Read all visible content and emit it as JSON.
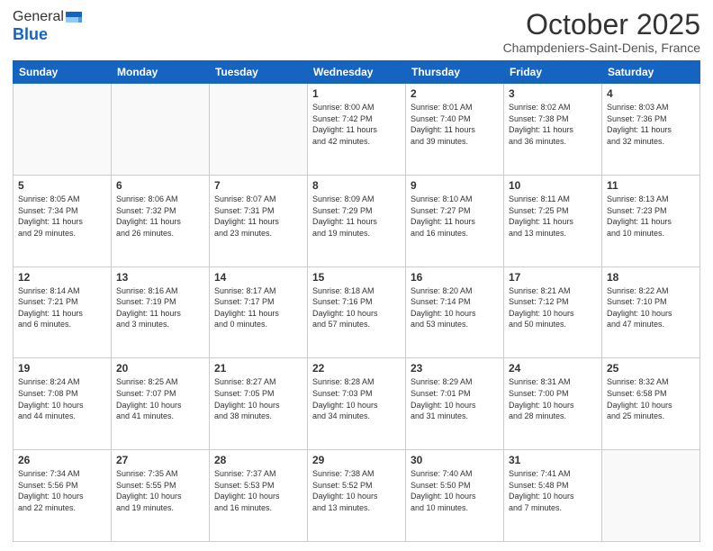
{
  "header": {
    "logo_general": "General",
    "logo_blue": "Blue",
    "month": "October 2025",
    "location": "Champdeniers-Saint-Denis, France"
  },
  "days_of_week": [
    "Sunday",
    "Monday",
    "Tuesday",
    "Wednesday",
    "Thursday",
    "Friday",
    "Saturday"
  ],
  "weeks": [
    [
      {
        "day": "",
        "info": ""
      },
      {
        "day": "",
        "info": ""
      },
      {
        "day": "",
        "info": ""
      },
      {
        "day": "1",
        "info": "Sunrise: 8:00 AM\nSunset: 7:42 PM\nDaylight: 11 hours\nand 42 minutes."
      },
      {
        "day": "2",
        "info": "Sunrise: 8:01 AM\nSunset: 7:40 PM\nDaylight: 11 hours\nand 39 minutes."
      },
      {
        "day": "3",
        "info": "Sunrise: 8:02 AM\nSunset: 7:38 PM\nDaylight: 11 hours\nand 36 minutes."
      },
      {
        "day": "4",
        "info": "Sunrise: 8:03 AM\nSunset: 7:36 PM\nDaylight: 11 hours\nand 32 minutes."
      }
    ],
    [
      {
        "day": "5",
        "info": "Sunrise: 8:05 AM\nSunset: 7:34 PM\nDaylight: 11 hours\nand 29 minutes."
      },
      {
        "day": "6",
        "info": "Sunrise: 8:06 AM\nSunset: 7:32 PM\nDaylight: 11 hours\nand 26 minutes."
      },
      {
        "day": "7",
        "info": "Sunrise: 8:07 AM\nSunset: 7:31 PM\nDaylight: 11 hours\nand 23 minutes."
      },
      {
        "day": "8",
        "info": "Sunrise: 8:09 AM\nSunset: 7:29 PM\nDaylight: 11 hours\nand 19 minutes."
      },
      {
        "day": "9",
        "info": "Sunrise: 8:10 AM\nSunset: 7:27 PM\nDaylight: 11 hours\nand 16 minutes."
      },
      {
        "day": "10",
        "info": "Sunrise: 8:11 AM\nSunset: 7:25 PM\nDaylight: 11 hours\nand 13 minutes."
      },
      {
        "day": "11",
        "info": "Sunrise: 8:13 AM\nSunset: 7:23 PM\nDaylight: 11 hours\nand 10 minutes."
      }
    ],
    [
      {
        "day": "12",
        "info": "Sunrise: 8:14 AM\nSunset: 7:21 PM\nDaylight: 11 hours\nand 6 minutes."
      },
      {
        "day": "13",
        "info": "Sunrise: 8:16 AM\nSunset: 7:19 PM\nDaylight: 11 hours\nand 3 minutes."
      },
      {
        "day": "14",
        "info": "Sunrise: 8:17 AM\nSunset: 7:17 PM\nDaylight: 11 hours\nand 0 minutes."
      },
      {
        "day": "15",
        "info": "Sunrise: 8:18 AM\nSunset: 7:16 PM\nDaylight: 10 hours\nand 57 minutes."
      },
      {
        "day": "16",
        "info": "Sunrise: 8:20 AM\nSunset: 7:14 PM\nDaylight: 10 hours\nand 53 minutes."
      },
      {
        "day": "17",
        "info": "Sunrise: 8:21 AM\nSunset: 7:12 PM\nDaylight: 10 hours\nand 50 minutes."
      },
      {
        "day": "18",
        "info": "Sunrise: 8:22 AM\nSunset: 7:10 PM\nDaylight: 10 hours\nand 47 minutes."
      }
    ],
    [
      {
        "day": "19",
        "info": "Sunrise: 8:24 AM\nSunset: 7:08 PM\nDaylight: 10 hours\nand 44 minutes."
      },
      {
        "day": "20",
        "info": "Sunrise: 8:25 AM\nSunset: 7:07 PM\nDaylight: 10 hours\nand 41 minutes."
      },
      {
        "day": "21",
        "info": "Sunrise: 8:27 AM\nSunset: 7:05 PM\nDaylight: 10 hours\nand 38 minutes."
      },
      {
        "day": "22",
        "info": "Sunrise: 8:28 AM\nSunset: 7:03 PM\nDaylight: 10 hours\nand 34 minutes."
      },
      {
        "day": "23",
        "info": "Sunrise: 8:29 AM\nSunset: 7:01 PM\nDaylight: 10 hours\nand 31 minutes."
      },
      {
        "day": "24",
        "info": "Sunrise: 8:31 AM\nSunset: 7:00 PM\nDaylight: 10 hours\nand 28 minutes."
      },
      {
        "day": "25",
        "info": "Sunrise: 8:32 AM\nSunset: 6:58 PM\nDaylight: 10 hours\nand 25 minutes."
      }
    ],
    [
      {
        "day": "26",
        "info": "Sunrise: 7:34 AM\nSunset: 5:56 PM\nDaylight: 10 hours\nand 22 minutes."
      },
      {
        "day": "27",
        "info": "Sunrise: 7:35 AM\nSunset: 5:55 PM\nDaylight: 10 hours\nand 19 minutes."
      },
      {
        "day": "28",
        "info": "Sunrise: 7:37 AM\nSunset: 5:53 PM\nDaylight: 10 hours\nand 16 minutes."
      },
      {
        "day": "29",
        "info": "Sunrise: 7:38 AM\nSunset: 5:52 PM\nDaylight: 10 hours\nand 13 minutes."
      },
      {
        "day": "30",
        "info": "Sunrise: 7:40 AM\nSunset: 5:50 PM\nDaylight: 10 hours\nand 10 minutes."
      },
      {
        "day": "31",
        "info": "Sunrise: 7:41 AM\nSunset: 5:48 PM\nDaylight: 10 hours\nand 7 minutes."
      },
      {
        "day": "",
        "info": ""
      }
    ]
  ]
}
